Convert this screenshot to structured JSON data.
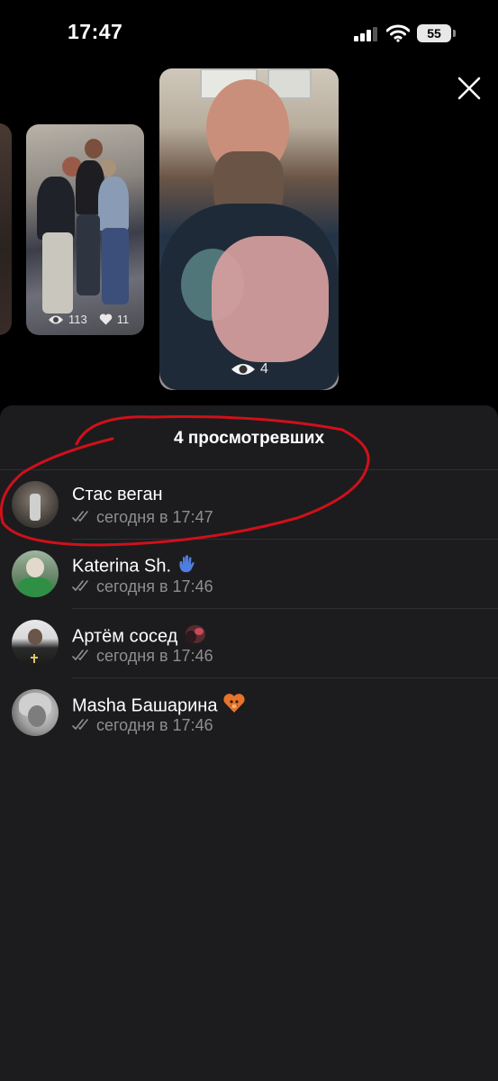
{
  "status_bar": {
    "time": "17:47",
    "battery": "55"
  },
  "stories": [
    {
      "views": "113",
      "likes": "11"
    },
    {
      "views": "4"
    }
  ],
  "viewers_sheet": {
    "title": "4 просмотревших",
    "viewers": [
      {
        "name": "Стас веган",
        "seen": "сегодня в 17:47",
        "emoji": ""
      },
      {
        "name": "Katerina Sh.",
        "seen": "сегодня в 17:46",
        "emoji": "waving-hand"
      },
      {
        "name": "Артём сосед",
        "seen": "сегодня в 17:46",
        "emoji": "custom-sticker"
      },
      {
        "name": "Masha Башарина",
        "seen": "сегодня в 17:46",
        "emoji": "orange-heart-face"
      }
    ]
  },
  "colors": {
    "background": "#000000",
    "sheet": "#1c1c1e",
    "secondary_text": "#8e8e93",
    "annotation": "#d0101a"
  }
}
